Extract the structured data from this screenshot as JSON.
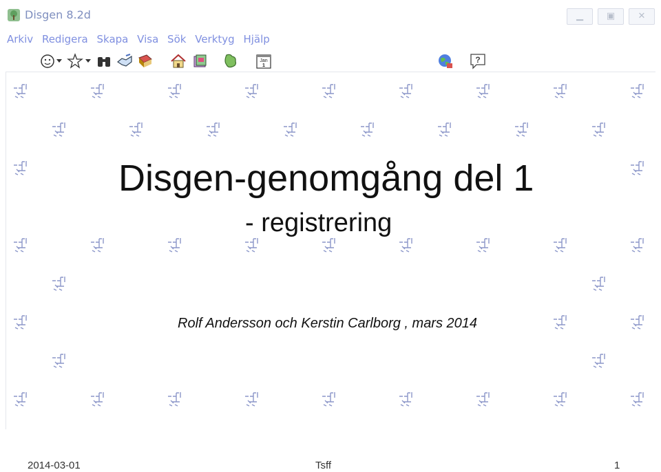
{
  "window": {
    "title": "Disgen 8.2d",
    "controls": {
      "minimize": "▁",
      "maximize": "▣",
      "close": "✕"
    }
  },
  "menubar": {
    "items": [
      "Arkiv",
      "Redigera",
      "Skapa",
      "Visa",
      "Sök",
      "Verktyg",
      "Hjälp"
    ]
  },
  "toolbar": {
    "icons": [
      "person-icon",
      "dropdown-icon",
      "star-person-icon",
      "dropdown-icon",
      "binoculars-icon",
      "handshake-icon",
      "book-icon",
      "house-icon",
      "family-book-icon",
      "map-icon",
      "calendar-icon",
      "globe-icon",
      "help-icon"
    ],
    "calendar_month": "Jan",
    "calendar_day": "1",
    "help_glyph": "?"
  },
  "slide": {
    "title": "Disgen-genomgång del 1",
    "subtitle": "- registrering",
    "authors": "Rolf Andersson och Kerstin Carlborg , mars 2014"
  },
  "footer": {
    "date": "2014-03-01",
    "center": "Tsff",
    "page": "1"
  },
  "colors": {
    "menu_text": "#7f8fe0",
    "title_text": "#7f8fbf",
    "pattern": "#8b96c9"
  }
}
